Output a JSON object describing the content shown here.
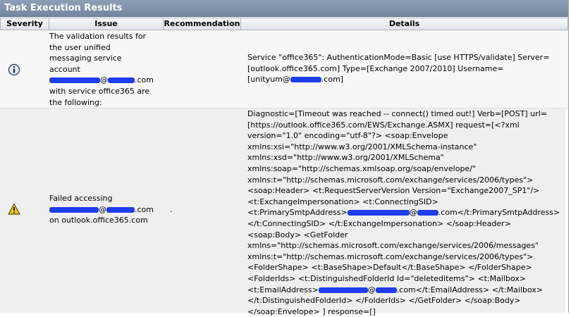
{
  "panel": {
    "title": "Task Execution Results"
  },
  "columns": [
    "Severity",
    "Issue",
    "Recommendation",
    "Details"
  ],
  "rows": [
    {
      "severity_icon": "info-icon",
      "issue": {
        "line1": "The validation results for",
        "line2": "the user unified",
        "line3": "messaging service",
        "line4": "account",
        "line5_suffix": "@",
        "line5_domain": ".com",
        "line6": "with service office365 are",
        "line7": "the following:"
      },
      "recommendation": "",
      "details": {
        "line1": "Service \"office365\": AuthenticationMode=Basic [use HTTPS/validate] Server=",
        "line2": "[outlook.office365.com] Type=[Exchange 2007/2010] Username=",
        "line3_prefix": "[unityum@",
        "line3_suffix": ".com]"
      }
    },
    {
      "severity_icon": "warning-icon",
      "issue": {
        "line1": "Failed accessing",
        "line2_at": "@",
        "line2_domain": ".com",
        "line3": "on outlook.office365.com"
      },
      "recommendation": ".",
      "details": {
        "l1": "Diagnostic=[Timeout was reached -- connect() timed out!] Verb=[POST] url=",
        "l2": "[https://outlook.office365.com/EWS/Exchange.ASMX] request=[<?xml",
        "l3": "version=\"1.0\" encoding=\"utf-8\"?> <soap:Envelope",
        "l4": "xmlns:xsi=\"http://www.w3.org/2001/XMLSchema-instance\"",
        "l5": "xmlns:xsd=\"http://www.w3.org/2001/XMLSchema\"",
        "l6": "xmlns:soap=\"http://schemas.xmlsoap.org/soap/envelope/\"",
        "l7": "xmlns:t=\"http://schemas.microsoft.com/exchange/services/2006/types\">",
        "l8": "<soap:Header> <t:RequestServerVersion Version=\"Exchange2007_SP1\"/>",
        "l9": "<t:ExchangeImpersonation> <t:ConnectingSID>",
        "l10_prefix": "<t:PrimarySmtpAddress>",
        "l10_mid": "@",
        "l10_suffix": ".com</t:PrimarySmtpAddress>",
        "l11": "</t:ConnectingSID> </t:ExchangeImpersonation> </soap:Header>",
        "l12": "<soap:Body> <GetFolder",
        "l13": "xmlns=\"http://schemas.microsoft.com/exchange/services/2006/messages\"",
        "l14": "xmlns:t=\"http://schemas.microsoft.com/exchange/services/2006/types\">",
        "l15": "<FolderShape> <t:BaseShape>Default</t:BaseShape> </FolderShape>",
        "l16": "<FolderIds> <t:DistinguishedFolderId Id=\"deleteditems\"> <t:Mailbox>",
        "l17_prefix": "<t:EmailAddress>",
        "l17_mid": "@",
        "l17_suffix": ".com</t:EmailAddress> </t:Mailbox>",
        "l18": "</t:DistinguishedFolderId> </FolderIds> </GetFolder> </soap:Body>",
        "l19": "</soap:Envelope> ] response=[]"
      }
    }
  ],
  "colors": {
    "title_bar": "#7f91a9",
    "redaction": "#1f3df0"
  }
}
